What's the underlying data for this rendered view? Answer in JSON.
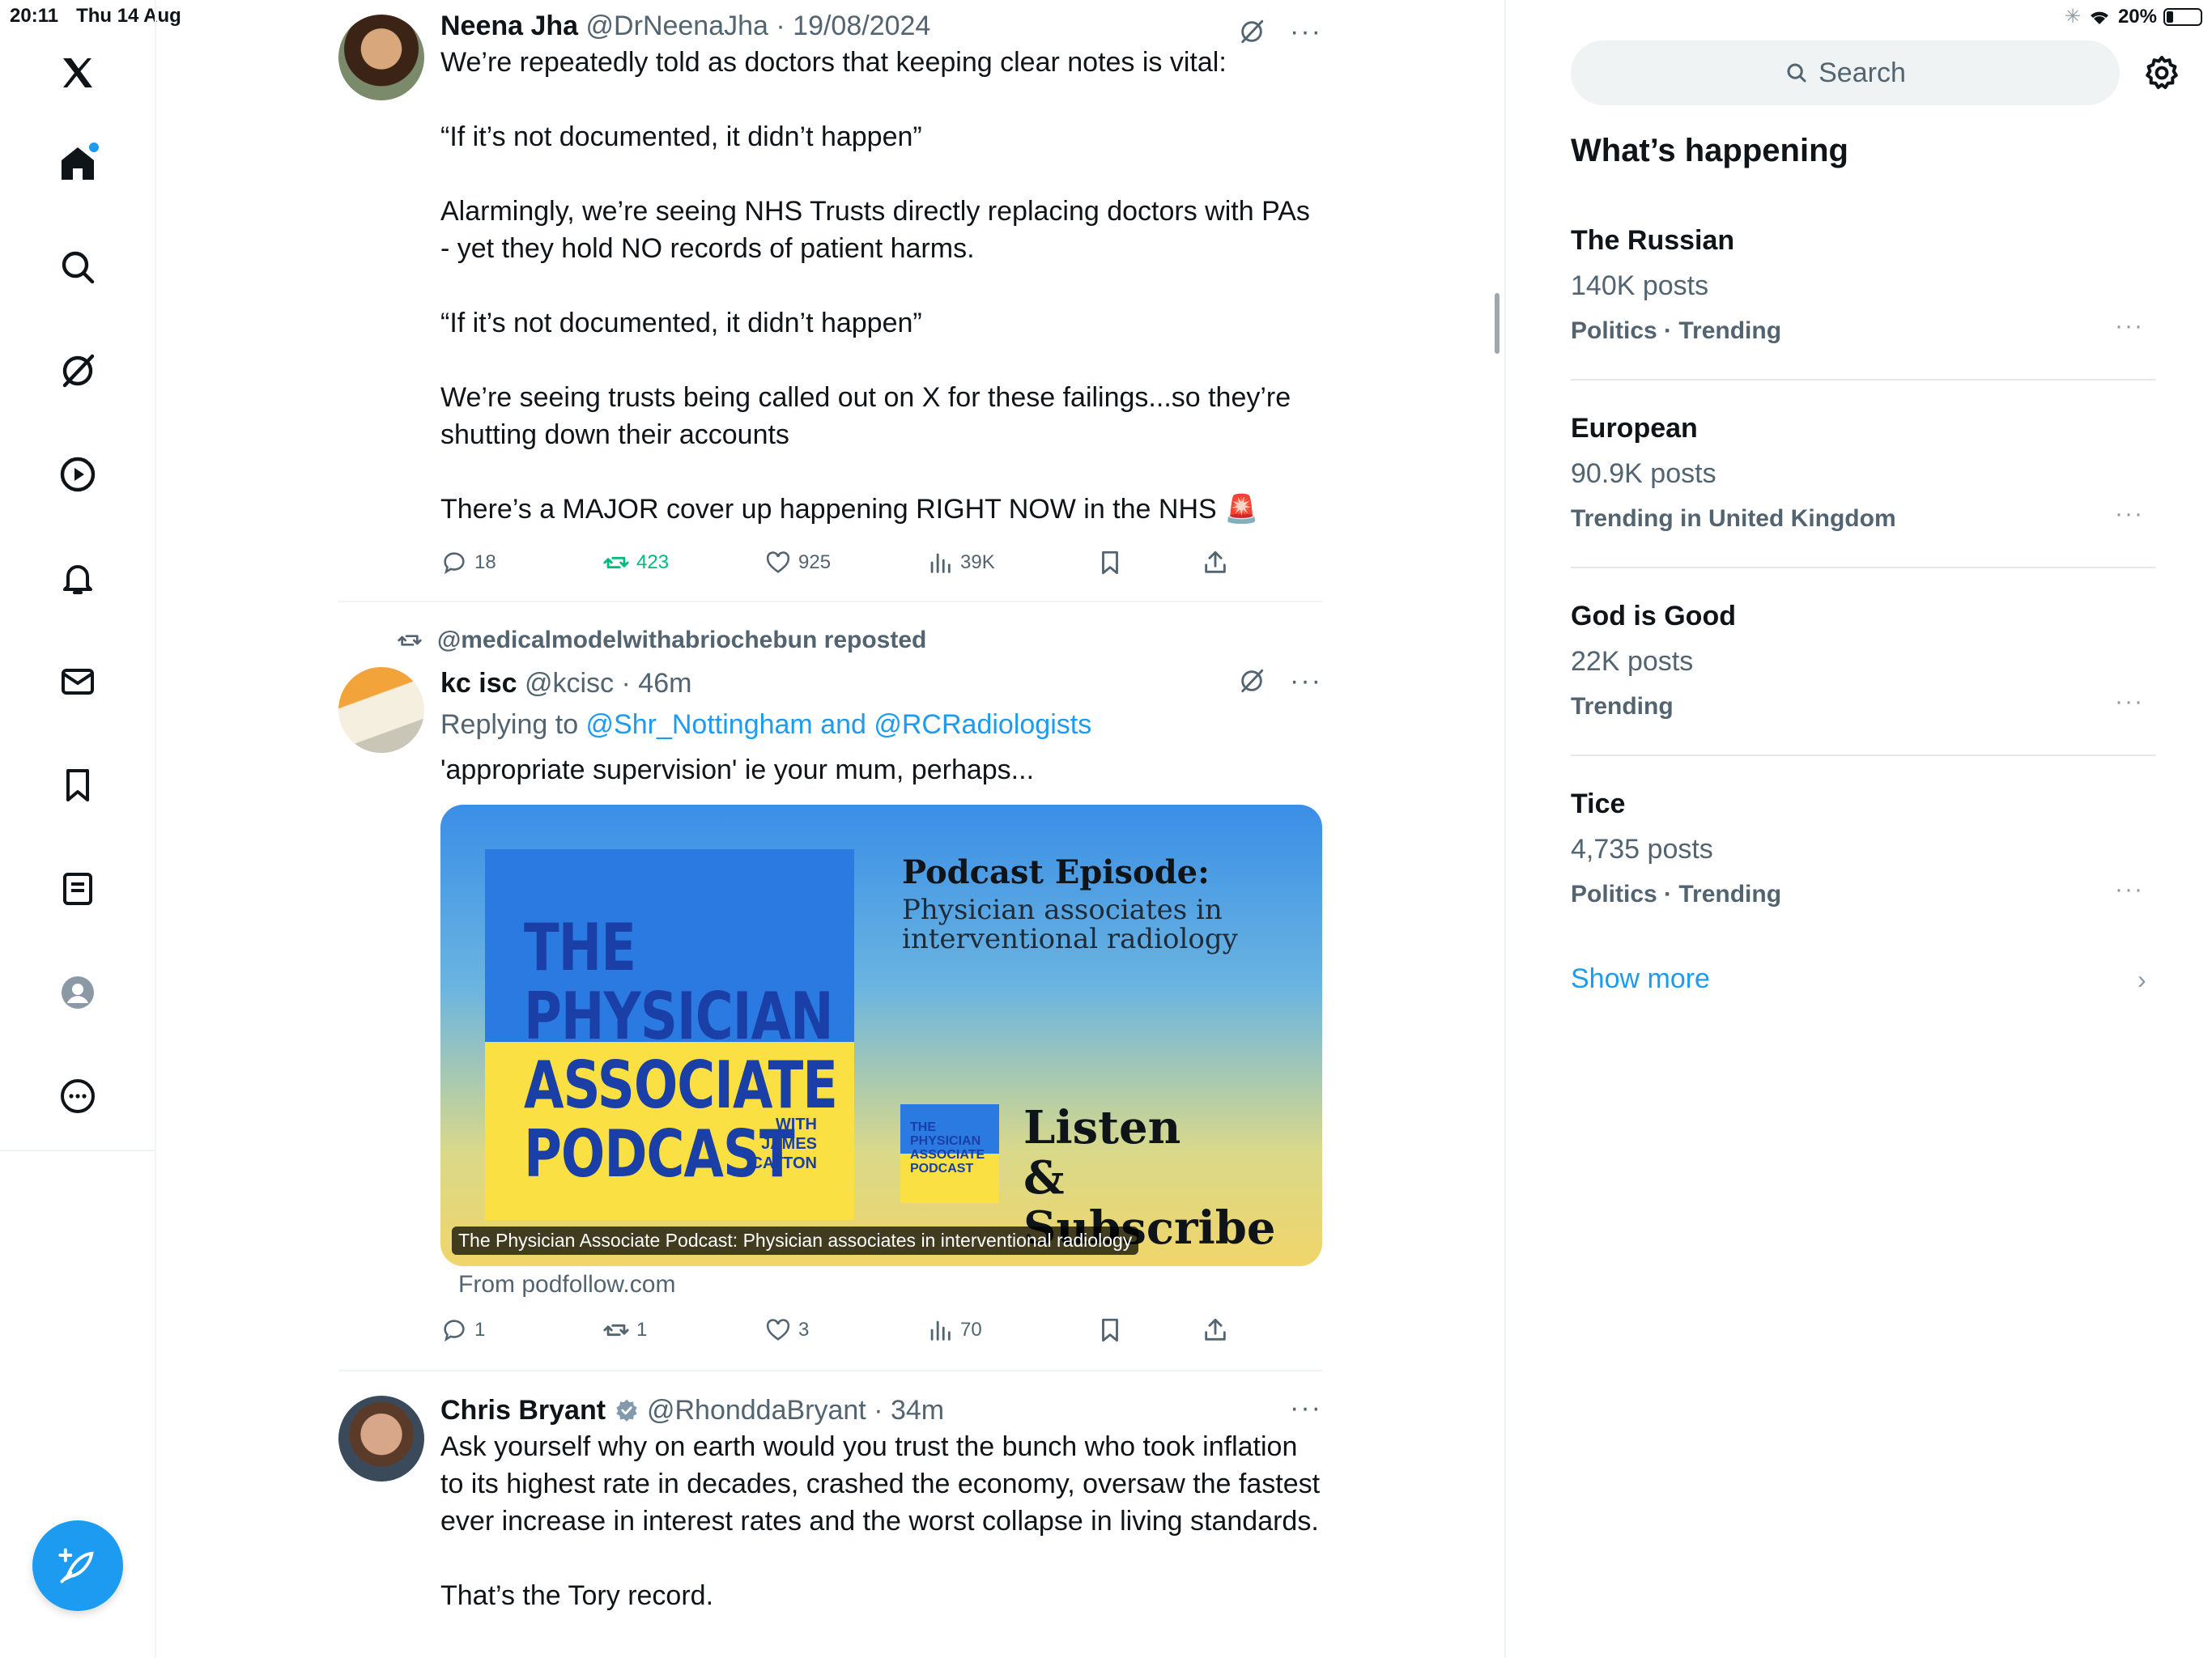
{
  "status_bar": {
    "time": "20:11",
    "date": "Thu 14 Aug",
    "battery": "20%",
    "battery_level": 0.2
  },
  "nav": {
    "items": [
      "X logo",
      "Home",
      "Explore",
      "Grok",
      "Video",
      "Notifications",
      "Messages",
      "Bookmarks",
      "Lists",
      "Profile",
      "More"
    ]
  },
  "tweets": [
    {
      "name": "Neena Jha",
      "handle": "@DrNeenaJha",
      "time": "19/08/2024",
      "paragraphs": [
        "We’re repeatedly told as doctors that keeping clear notes is vital:",
        "“If it’s not documented, it didn’t happen”",
        "Alarmingly, we’re seeing NHS Trusts directly replacing doctors with PAs - yet they hold NO records of patient harms.",
        "“If it’s not documented, it didn’t happen”",
        "We’re seeing trusts being called out on X for these failings...so they’re shutting down their accounts",
        "There’s a MAJOR cover up happening RIGHT NOW in the NHS 🚨"
      ],
      "replies": "18",
      "reposts": "423",
      "likes": "925",
      "views": "39K"
    },
    {
      "reposted_by": "@medicalmodelwithabriochebun reposted",
      "name": "kc isc",
      "handle": "@kcisc",
      "time": "46m",
      "replying_prefix": "Replying to ",
      "replying_to": "@Shr_Nottingham and @RCRadiologists",
      "text": "'appropriate supervision'  ie your mum, perhaps...",
      "card": {
        "cover_title": "THE PHYSICIAN ASSOCIATE PODCAST",
        "cover_with": "WITH JAMES CATTON",
        "episode_title": "Podcast Episode:",
        "episode_subtitle": "Physician associates in interventional radiology",
        "mini_cover_text": "THE PHYSICIAN ASSOCIATE PODCAST",
        "listen_line1": "Listen",
        "listen_line2": "& Subscribe",
        "caption": "The Physician Associate Podcast: Physician associates in interventional radiology",
        "source": "From podfollow.com"
      },
      "replies": "1",
      "reposts": "1",
      "likes": "3",
      "views": "70"
    },
    {
      "name": "Chris Bryant",
      "handle": "@RhonddaBryant",
      "time": "34m",
      "verified": true,
      "paragraphs": [
        "Ask yourself why on earth would you trust the bunch who took inflation to its highest rate in decades, crashed the economy, oversaw the fastest ever increase in interest rates and the worst collapse in living standards.",
        "That’s the Tory record."
      ]
    }
  ],
  "sidebar": {
    "search_placeholder": "Search",
    "title": "What’s happening",
    "trends": [
      {
        "name": "The Russian",
        "count": "140K posts",
        "meta": "Politics · Trending"
      },
      {
        "name": "European",
        "count": "90.9K posts",
        "meta": "Trending in United Kingdom"
      },
      {
        "name": "God is Good",
        "count": "22K posts",
        "meta": "Trending"
      },
      {
        "name": "Tice",
        "count": "4,735 posts",
        "meta": "Politics · Trending"
      }
    ],
    "show_more": "Show more"
  },
  "colors": {
    "accent": "#1d9bf0",
    "repost_active": "#00ba7c",
    "text_secondary": "#536471"
  }
}
